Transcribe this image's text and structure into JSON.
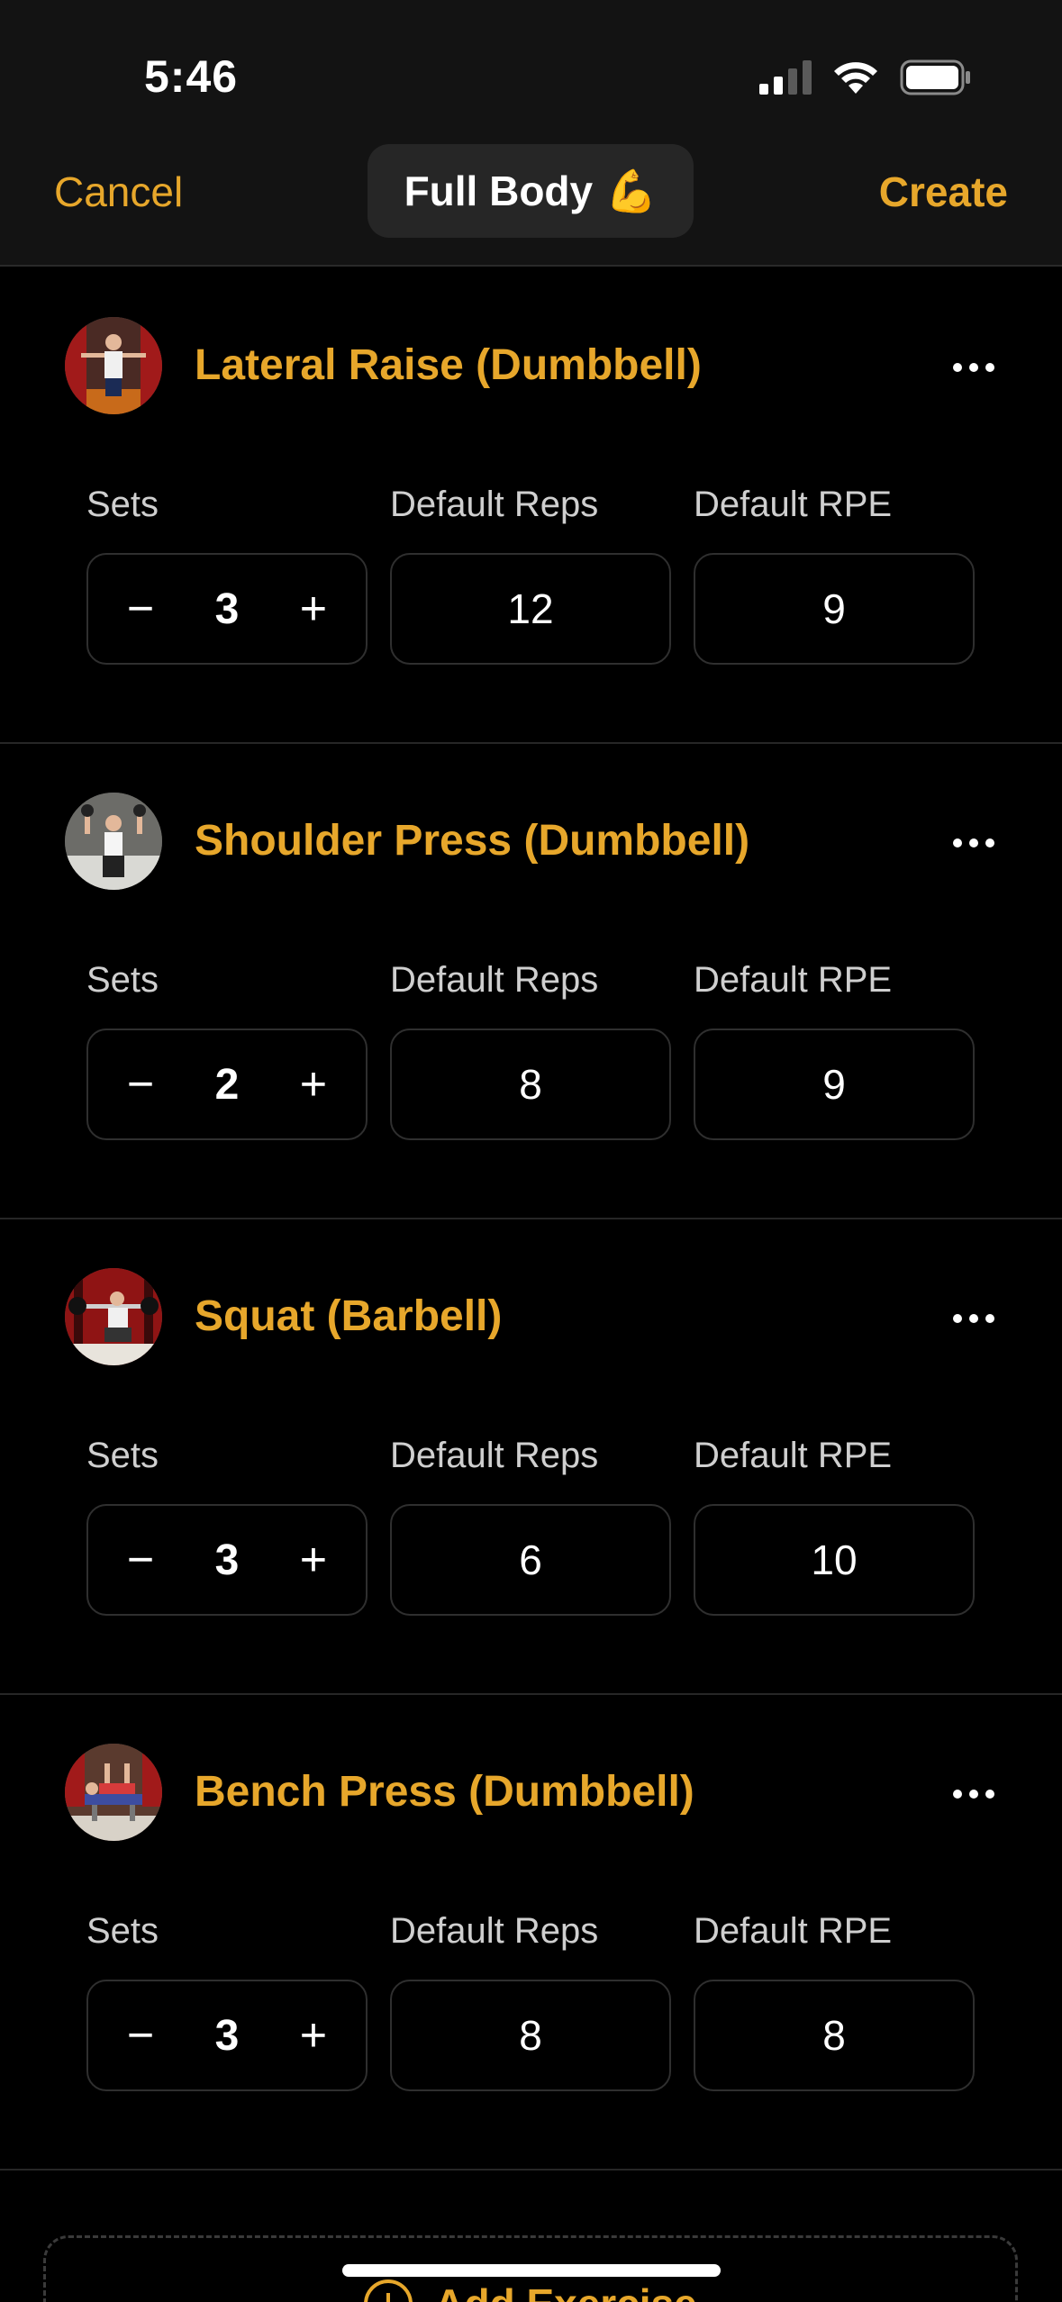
{
  "status": {
    "time": "5:46"
  },
  "nav": {
    "cancel_label": "Cancel",
    "title": "Full Body",
    "title_emoji": "💪",
    "create_label": "Create"
  },
  "labels": {
    "sets": "Sets",
    "default_reps": "Default Reps",
    "default_rpe": "Default RPE",
    "minus": "−",
    "plus": "+"
  },
  "exercises": [
    {
      "name": "Lateral Raise (Dumbbell)",
      "sets": "3",
      "reps": "12",
      "rpe": "9"
    },
    {
      "name": "Shoulder Press (Dumbbell)",
      "sets": "2",
      "reps": "8",
      "rpe": "9"
    },
    {
      "name": "Squat (Barbell)",
      "sets": "3",
      "reps": "6",
      "rpe": "10"
    },
    {
      "name": "Bench Press (Dumbbell)",
      "sets": "3",
      "reps": "8",
      "rpe": "8"
    }
  ],
  "add_exercise_label": "Add Exercise",
  "colors": {
    "accent": "#e7a72b",
    "background": "#000000",
    "bar": "#131313"
  }
}
